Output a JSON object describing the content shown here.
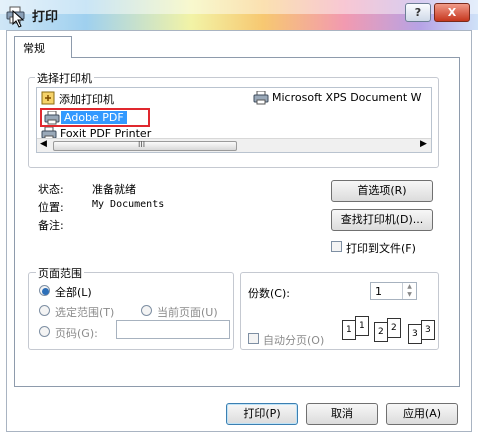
{
  "window": {
    "title": "打印",
    "help_label": "?",
    "close_label": "X"
  },
  "tabs": [
    {
      "label": "常规"
    }
  ],
  "printer_group": {
    "title": "选择打印机",
    "printers": [
      {
        "label": "添加打印机",
        "icon": "add-printer-icon"
      },
      {
        "label": "Microsoft XPS Document W",
        "icon": "printer-icon"
      },
      {
        "label": "Adobe PDF",
        "icon": "printer-icon",
        "selected": true
      },
      {
        "label": "Foxit PDF Printer",
        "icon": "printer-icon"
      }
    ],
    "scroll_grip": "III"
  },
  "status": {
    "status_label": "状态:",
    "status_value": "准备就绪",
    "location_label": "位置:",
    "location_value": "My Documents",
    "comment_label": "备注:",
    "comment_value": ""
  },
  "buttons": {
    "preferences": "首选项(R)",
    "find_printer": "查找打印机(D)...",
    "print": "打印(P)",
    "cancel": "取消",
    "apply": "应用(A)"
  },
  "print_to_file": {
    "label": "打印到文件(F)",
    "checked": false
  },
  "page_range": {
    "title": "页面范围",
    "all": "全部(L)",
    "selection": "选定范围(T)",
    "current_page": "当前页面(U)",
    "pages": "页码(G):",
    "pages_value": "",
    "selected": "all"
  },
  "copies": {
    "label": "份数(C):",
    "value": "1",
    "collate_label": "自动分页(O)",
    "collate_checked": false
  },
  "collate_pages": [
    "1",
    "1",
    "2",
    "2",
    "3",
    "3"
  ],
  "colors": {
    "selection_highlight": "#e0282e",
    "selected_bg": "#3399ff"
  }
}
